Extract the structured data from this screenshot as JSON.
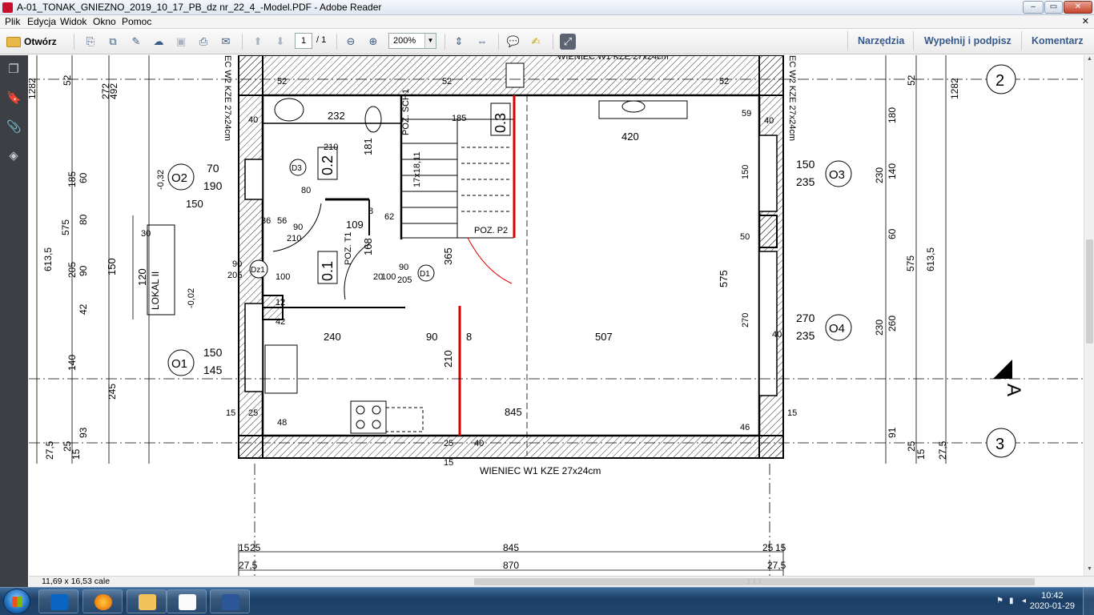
{
  "window": {
    "title": "A-01_TONAK_GNIEZNO_2019_10_17_PB_dz nr_22_4_-Model.PDF - Adobe Reader",
    "controls": [
      "–",
      "▭",
      "✕"
    ]
  },
  "menu": [
    "Plik",
    "Edycja",
    "Widok",
    "Okno",
    "Pomoc"
  ],
  "menu_close": "✕",
  "toolbar": {
    "open_label": "Otwórz",
    "page_current": "1",
    "page_total": "/ 1",
    "zoom": "200%",
    "right_links": [
      "Narzędzia",
      "Wypełnij i podpisz",
      "Komentarz"
    ]
  },
  "status": {
    "page_size": "11,69 x 16,53 cale"
  },
  "taskbar": {
    "time": "10:42",
    "date": "2020-01-29"
  },
  "drawing": {
    "left_dims_outer": [
      "1282",
      "272",
      "492",
      "613,5",
      "245",
      "93",
      "27,5"
    ],
    "left_dims_inner": [
      "52",
      "185",
      "60",
      "80",
      "575",
      "205",
      "90",
      "42",
      "140",
      "25",
      "15"
    ],
    "right_dims_outer": [
      "1282",
      "575",
      "613,5",
      "27,5"
    ],
    "right_dims_inner": [
      "52",
      "180",
      "230",
      "140",
      "60",
      "230",
      "260",
      "91",
      "25",
      "15"
    ],
    "beam_label": "WIENIEC W1 KZE 27x24cm",
    "wall_label_top": "WIENIEC W1 KZE 27x24cm",
    "side_label": "EC W2 KZE 27x24cm",
    "rooms": [
      {
        "id": "0.2",
        "label": "0.2"
      },
      {
        "id": "0.1",
        "label": "0.1"
      },
      {
        "id": "0.3",
        "label": "0.3"
      }
    ],
    "room_numbers": [
      "420",
      "507",
      "575",
      "845",
      "232",
      "181",
      "109",
      "168",
      "365",
      "240",
      "210",
      "90",
      "8",
      "150",
      "120",
      "150"
    ],
    "tags": [
      "O2",
      "O1",
      "O3",
      "O4",
      "D3",
      "Dz1",
      "D1"
    ],
    "window_labels": [
      {
        "tag": "O2",
        "top": "70",
        "bottom": "190"
      },
      {
        "tag": "O1",
        "top": "150",
        "bottom": "145"
      },
      {
        "tag": "O3",
        "top": "150",
        "bottom": "235"
      },
      {
        "tag": "O4",
        "top": "270",
        "bottom": "235"
      }
    ],
    "stair_label": "17x18,11",
    "poz_labels": [
      "POZ. SCH1",
      "POZ. P2",
      "POZ. T1"
    ],
    "lokal": "LOKAL II",
    "small_dims": [
      "-0,32",
      "-0,02",
      "30",
      "80",
      "40",
      "59",
      "185",
      "52",
      "52",
      "52",
      "40",
      "50",
      "48",
      "46",
      "15",
      "15",
      "25",
      "40",
      "25",
      "15",
      "40",
      "8",
      "12",
      "42",
      "210",
      "100",
      "90",
      "205",
      "90",
      "205",
      "90",
      "210",
      "100",
      "20",
      "56",
      "36",
      "62",
      "270",
      "150"
    ],
    "axis_bubbles": [
      "2",
      "3"
    ],
    "section_mark": "A",
    "bottom_dims": {
      "row1": [
        "15",
        "25",
        "845",
        "25",
        "15"
      ],
      "row2": [
        "27,5",
        "870",
        "27,5"
      ]
    }
  }
}
